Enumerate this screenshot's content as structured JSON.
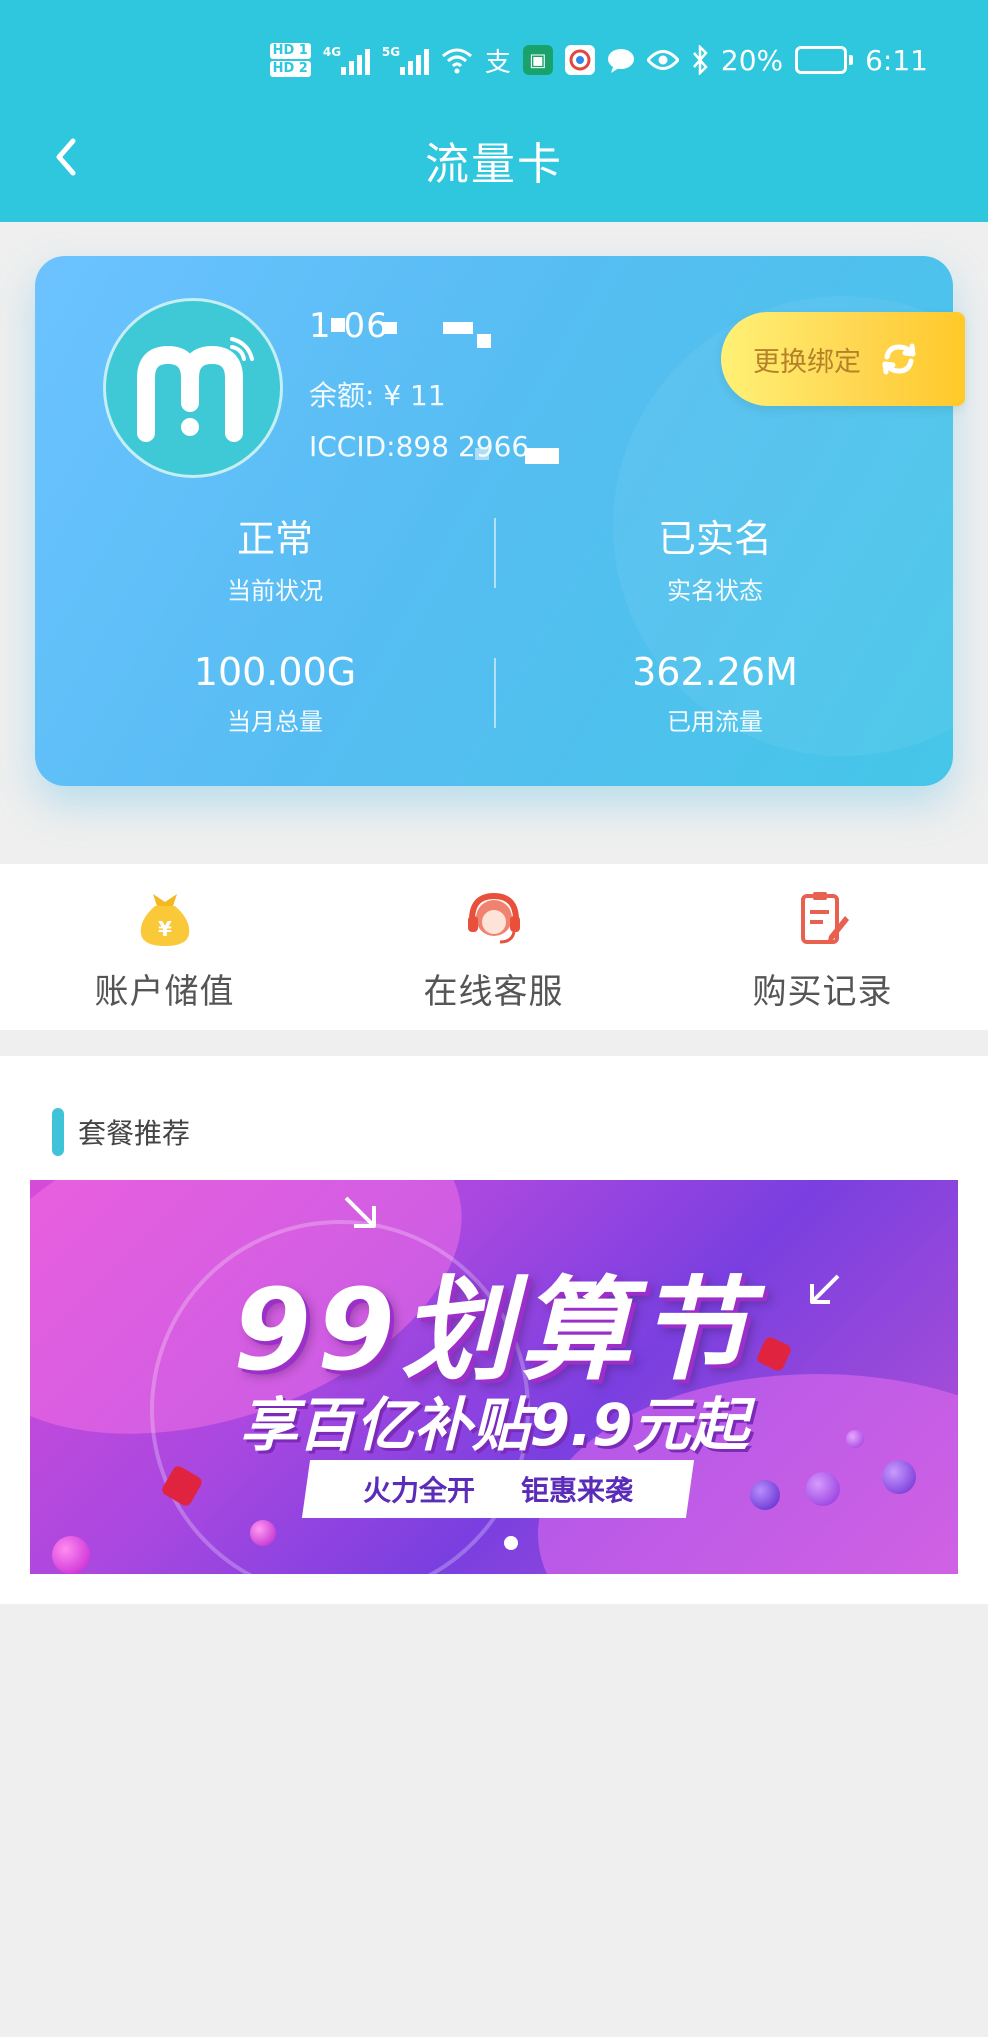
{
  "status_bar": {
    "hd1": "HD 1",
    "hd2": "HD 2",
    "net1": "4G",
    "net2": "5G",
    "battery": "20%",
    "time": "6:11",
    "icons": [
      "signal-icon",
      "wifi-icon",
      "alipay-icon",
      "app-icon",
      "browser-icon",
      "message-icon",
      "eye-icon",
      "bluetooth-icon",
      "battery-icon"
    ]
  },
  "header": {
    "title": "流量卡",
    "back_icon": "chevron-left-icon"
  },
  "card": {
    "phone": "1    06",
    "balance": "余额: ¥ 11",
    "iccid": "ICCID:898     2966",
    "rebind_label": "更换绑定",
    "stats": [
      {
        "value": "正常",
        "label": "当前状况"
      },
      {
        "value": "已实名",
        "label": "实名状态"
      },
      {
        "value": "100.00G",
        "label": "当月总量"
      },
      {
        "value": "362.26M",
        "label": "已用流量"
      }
    ]
  },
  "shortcuts": [
    {
      "label": "账户储值",
      "icon": "money-bag-icon"
    },
    {
      "label": "在线客服",
      "icon": "headset-icon"
    },
    {
      "label": "购买记录",
      "icon": "clipboard-edit-icon"
    }
  ],
  "recommend": {
    "title": "套餐推荐",
    "banner": {
      "headline": "99划算节",
      "subline": "享百亿补贴9.9元起",
      "tag_left": "火力全开",
      "tag_right": "钜惠来袭"
    }
  },
  "colors": {
    "header": "#2ec7dd",
    "card_start": "#6cc2ff",
    "card_end": "#45c6e8",
    "rebind": "#ffd54f",
    "accent": "#3ec3d8"
  }
}
